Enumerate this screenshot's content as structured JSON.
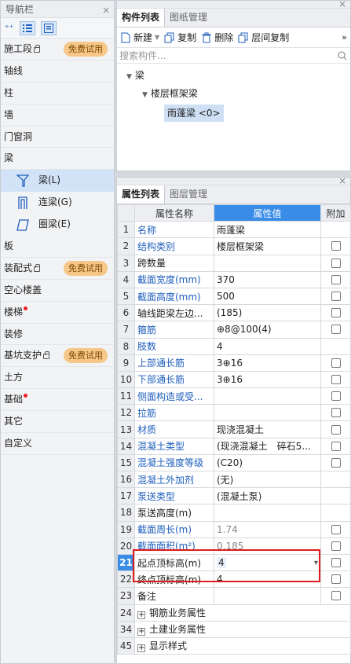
{
  "nav": {
    "title": "导航栏",
    "sections_top": [
      {
        "label": "施工段",
        "lock": true,
        "badge": "免费试用"
      },
      {
        "label": "轴线"
      },
      {
        "label": "柱"
      },
      {
        "label": "墙"
      },
      {
        "label": "门窗洞"
      },
      {
        "label": "梁"
      }
    ],
    "sub_items": [
      {
        "label": "梁(L)",
        "selected": true,
        "icon": "beam-icon"
      },
      {
        "label": "连梁(G)",
        "icon": "coupling-beam-icon"
      },
      {
        "label": "圈梁(E)",
        "icon": "ring-beam-icon"
      }
    ],
    "sections_bottom": [
      {
        "label": "板"
      },
      {
        "label": "装配式",
        "lock": true,
        "badge": "免费试用"
      },
      {
        "label": "空心楼盖"
      },
      {
        "label": "楼梯",
        "dot": true
      },
      {
        "label": "装修"
      },
      {
        "label": "基坑支护",
        "lock": true,
        "badge": "免费试用"
      },
      {
        "label": "土方"
      },
      {
        "label": "基础",
        "dot": true
      },
      {
        "label": "其它"
      },
      {
        "label": "自定义"
      }
    ]
  },
  "component_panel": {
    "tabs": [
      "构件列表",
      "图纸管理"
    ],
    "toolbar": {
      "new": "新建",
      "copy": "复制",
      "delete": "删除",
      "floor_copy": "层间复制",
      "more": "»"
    },
    "search_placeholder": "搜索构件...",
    "tree": {
      "root": "梁",
      "child": "楼层框架梁",
      "leaf": "雨蓬梁 <0>"
    }
  },
  "property_panel": {
    "tabs": [
      "属性列表",
      "图层管理"
    ],
    "headers": {
      "name": "属性名称",
      "value": "属性值",
      "extra": "附加"
    },
    "rows": [
      {
        "no": "1",
        "name": "名称",
        "value": "雨蓬梁",
        "blue": true,
        "cb": false
      },
      {
        "no": "2",
        "name": "结构类别",
        "value": "楼层框架梁",
        "blue": true,
        "cb": true
      },
      {
        "no": "3",
        "name": "跨数量",
        "value": "",
        "blue": false,
        "cb": true
      },
      {
        "no": "4",
        "name": "截面宽度(mm)",
        "value": "370",
        "blue": true,
        "cb": true
      },
      {
        "no": "5",
        "name": "截面高度(mm)",
        "value": "500",
        "blue": true,
        "cb": true
      },
      {
        "no": "6",
        "name": "轴线距梁左边...",
        "value": "(185)",
        "blue": false,
        "cb": true
      },
      {
        "no": "7",
        "name": "箍筋",
        "value": "⊕8@100(4)",
        "blue": true,
        "cb": true
      },
      {
        "no": "8",
        "name": "肢数",
        "value": "4",
        "blue": true,
        "cb": false
      },
      {
        "no": "9",
        "name": "上部通长筋",
        "value": "3⊕16",
        "blue": true,
        "cb": true
      },
      {
        "no": "10",
        "name": "下部通长筋",
        "value": "3⊕16",
        "blue": true,
        "cb": true
      },
      {
        "no": "11",
        "name": "侧面构造或受...",
        "value": "",
        "blue": true,
        "cb": true
      },
      {
        "no": "12",
        "name": "拉筋",
        "value": "",
        "blue": true,
        "cb": true
      },
      {
        "no": "13",
        "name": "材质",
        "value": "现浇混凝土",
        "blue": true,
        "cb": true
      },
      {
        "no": "14",
        "name": "混凝土类型",
        "value": "(现浇混凝土　碎石5...",
        "blue": true,
        "cb": true
      },
      {
        "no": "15",
        "name": "混凝土强度等级",
        "value": "(C20)",
        "blue": true,
        "cb": true
      },
      {
        "no": "16",
        "name": "混凝土外加剂",
        "value": "(无)",
        "blue": true,
        "cb": false
      },
      {
        "no": "17",
        "name": "泵送类型",
        "value": "(混凝土泵)",
        "blue": true,
        "cb": false
      },
      {
        "no": "18",
        "name": "泵送高度(m)",
        "value": "",
        "blue": false,
        "cb": false
      },
      {
        "no": "19",
        "name": "截面周长(m)",
        "value": "1.74",
        "blue": true,
        "gray": true,
        "cb": true
      },
      {
        "no": "20",
        "name": "截面面积(m²)",
        "value": "0.185",
        "blue": true,
        "gray": true,
        "cb": true
      },
      {
        "no": "21",
        "name": "起点顶标高(m)",
        "value": "4",
        "blue": false,
        "cb": true,
        "selected": true,
        "dropdown": true
      },
      {
        "no": "22",
        "name": "终点顶标高(m)",
        "value": "4",
        "blue": false,
        "cb": true
      },
      {
        "no": "23",
        "name": "备注",
        "value": "",
        "blue": false,
        "cb": true
      }
    ],
    "groups": [
      {
        "no": "24",
        "name": "钢筋业务属性"
      },
      {
        "no": "34",
        "name": "土建业务属性"
      },
      {
        "no": "45",
        "name": "显示样式"
      }
    ]
  }
}
